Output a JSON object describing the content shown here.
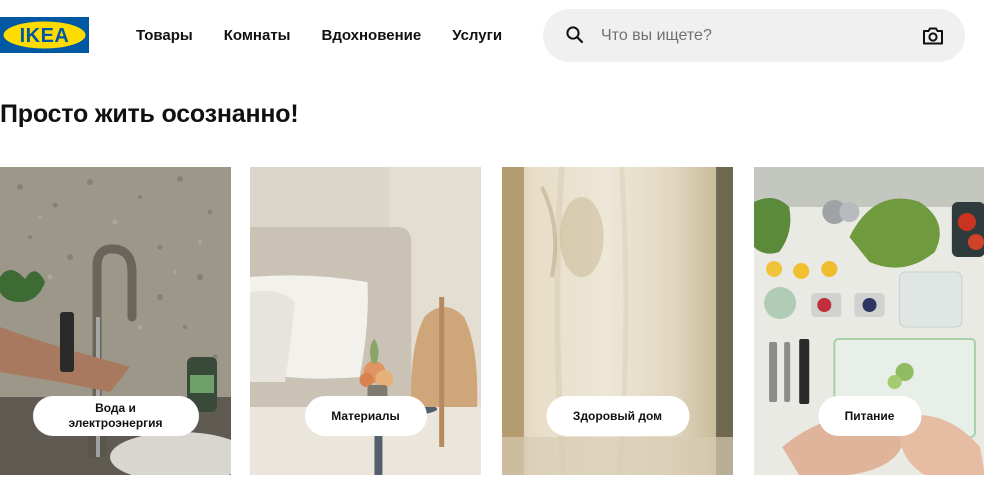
{
  "brand": {
    "logo_text": "IKEA",
    "colors": {
      "blue": "#0058a3",
      "yellow": "#ffdb00"
    }
  },
  "nav": {
    "items": [
      {
        "label": "Товары"
      },
      {
        "label": "Комнаты"
      },
      {
        "label": "Вдохновение"
      },
      {
        "label": "Услуги"
      }
    ]
  },
  "search": {
    "placeholder": "Что вы ищете?",
    "value": "",
    "icon": "search-icon",
    "camera_icon": "camera-icon"
  },
  "main": {
    "title": "Просто жить осознанно!",
    "cards": [
      {
        "label_line1": "Вода и",
        "label_line2": "электроэнергия"
      },
      {
        "label": "Материалы"
      },
      {
        "label": "Здоровый дом"
      },
      {
        "label": "Питание"
      }
    ]
  }
}
